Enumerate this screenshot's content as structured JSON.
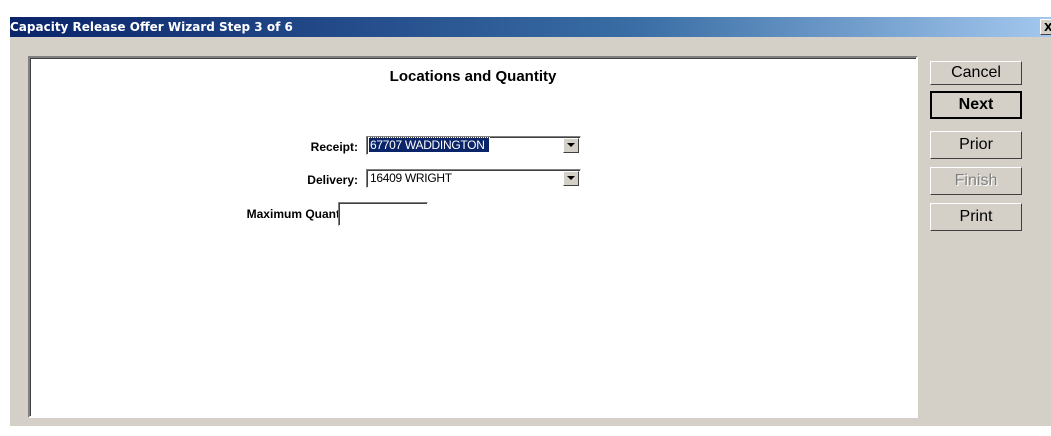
{
  "window": {
    "title": "Capacity Release Offer Wizard Step 3 of 6",
    "close_label": "X"
  },
  "panel": {
    "title": "Locations and Quantity",
    "receipt_label": "Receipt:",
    "receipt_value": "67707 WADDINGTON",
    "delivery_label": "Delivery:",
    "delivery_value": "16409 WRIGHT",
    "max_qty_label": "Maximum Quantity:",
    "max_qty_value": ""
  },
  "buttons": {
    "cancel": "Cancel",
    "next": "Next",
    "prior": "Prior",
    "finish": "Finish",
    "print": "Print"
  },
  "colors": {
    "selection": "#0a246a",
    "face": "#d4d0c8"
  }
}
